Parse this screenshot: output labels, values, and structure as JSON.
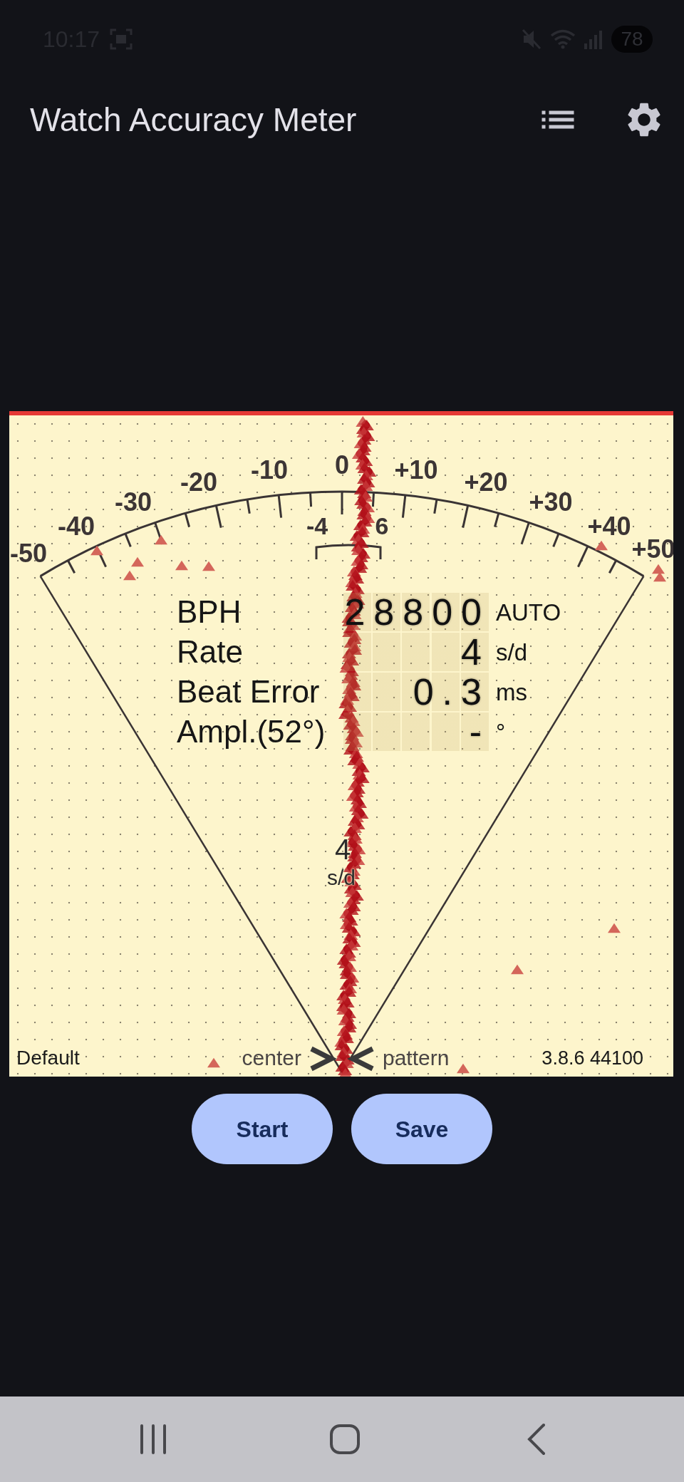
{
  "status_bar": {
    "time": "10:17",
    "battery": "78"
  },
  "app_bar": {
    "title": "Watch Accuracy Meter"
  },
  "meter": {
    "scale_labels": [
      "-50",
      "-40",
      "-30",
      "-20",
      "-10",
      "0",
      "+10",
      "+20",
      "+30",
      "+40",
      "+50"
    ],
    "range_labels": [
      "-4",
      "6"
    ],
    "readouts": [
      {
        "label": "BPH",
        "value": "28800",
        "unit": "AUTO"
      },
      {
        "label": "Rate",
        "value": "4",
        "unit": "s/d"
      },
      {
        "label": "Beat Error",
        "value": "0.3",
        "unit": "ms"
      },
      {
        "label": "Ampl.(52°)",
        "value": "-",
        "unit": "°"
      }
    ],
    "center_reading": {
      "value": "4",
      "unit": "s/d"
    },
    "footer": {
      "profile": "Default",
      "left_marker": "center",
      "right_marker": "pattern",
      "version": "3.8.6 44100"
    }
  },
  "buttons": [
    {
      "label": "Start"
    },
    {
      "label": "Save"
    }
  ]
}
